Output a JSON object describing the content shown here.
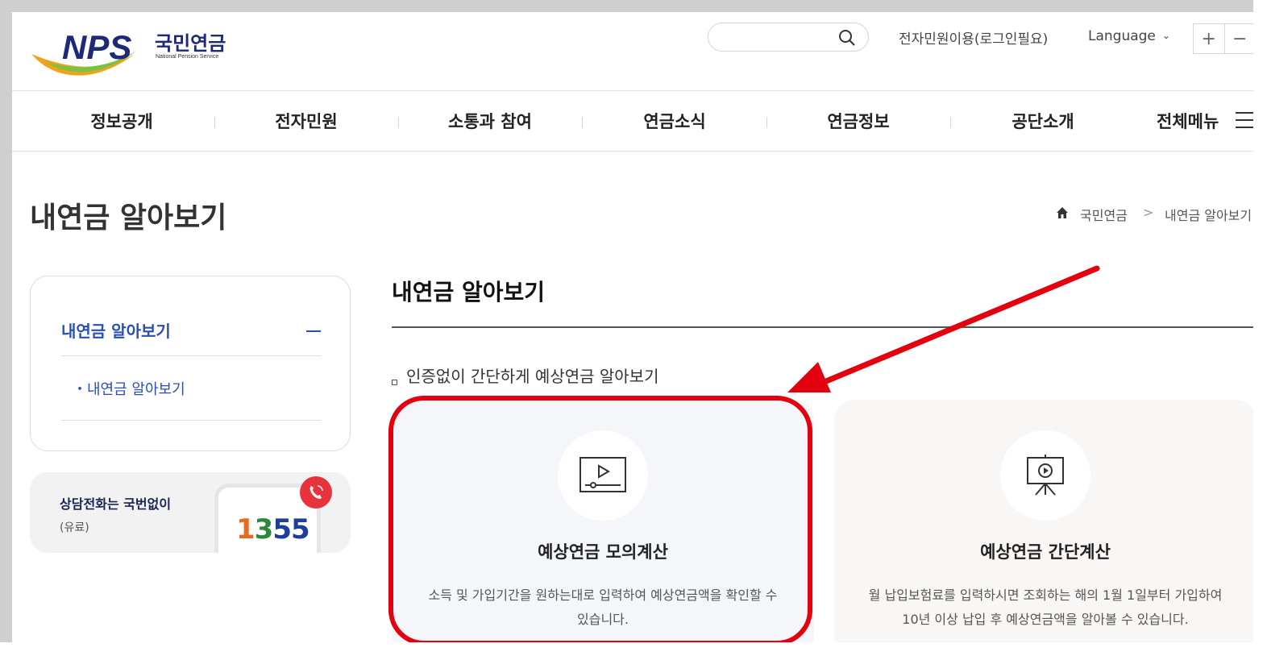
{
  "header": {
    "logo": {
      "text": "NPS",
      "korean": "국민연금",
      "english": "National Pension Service"
    },
    "search": {
      "placeholder": ""
    },
    "civil_service_link": "전자민원이용(로그인필요)",
    "language": "Language",
    "zoom_in": "+",
    "zoom_out": "−"
  },
  "nav": {
    "items": [
      {
        "label": "정보공개"
      },
      {
        "label": "전자민원"
      },
      {
        "label": "소통과 참여"
      },
      {
        "label": "연금소식"
      },
      {
        "label": "연금정보"
      },
      {
        "label": "공단소개"
      }
    ],
    "all_menu": "전체메뉴"
  },
  "page": {
    "title": "내연금 알아보기",
    "breadcrumb": [
      "국민연금",
      "내연금 알아보기"
    ],
    "breadcrumb_sep": ">"
  },
  "sidebar": {
    "header": "내연금 알아보기",
    "items": [
      {
        "label": "・내연금 알아보기"
      }
    ]
  },
  "call": {
    "title": "상담전화는 국번없이",
    "subtitle": "(유료)",
    "number_digits": [
      "1",
      "3",
      "5",
      "5"
    ],
    "number_colors": [
      "#e86b1b",
      "#2a8a3a",
      "#1c3f9c",
      "#1c3f9c"
    ]
  },
  "content": {
    "title": "내연금 알아보기",
    "subheading": "인증없이 간단하게 예상연금 알아보기",
    "cards": [
      {
        "title": "예상연금 모의계산",
        "desc": "소득 및 가입기간을 원하는대로 입력하여 예상연금액을 확인할 수 있습니다.",
        "icon": "video-play-icon"
      },
      {
        "title": "예상연금 간단계산",
        "desc": "월 납입보험료를 입력하시면 조회하는 해의 1월 1일부터 가입하여 10년 이상 납입 후 예상연금액을 알아볼 수 있습니다.",
        "icon": "presentation-board-icon"
      }
    ]
  },
  "annotation": {
    "color": "#e3000f"
  }
}
